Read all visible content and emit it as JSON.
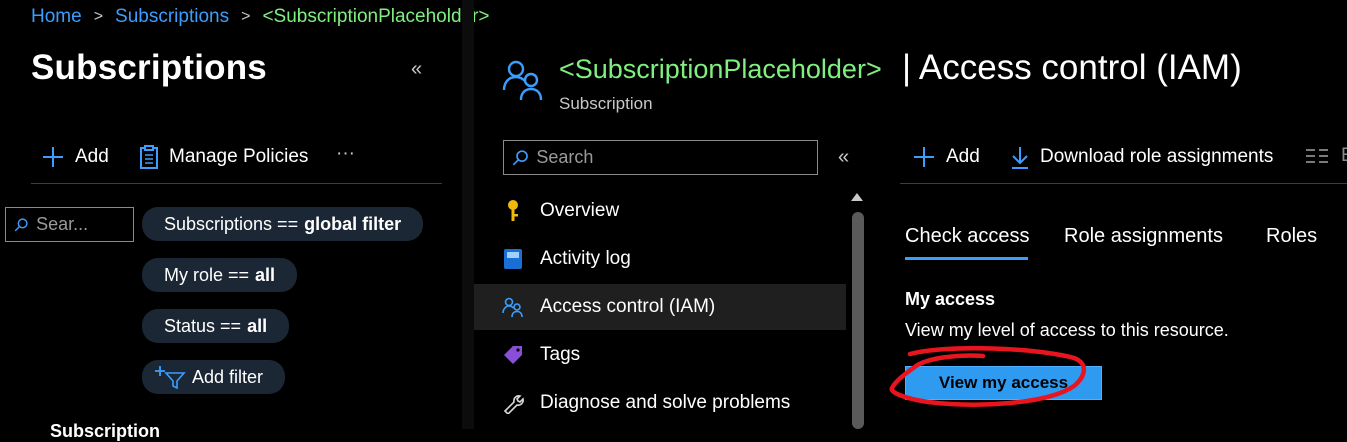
{
  "breadcrumb": {
    "home": "Home",
    "subscriptions": "Subscriptions",
    "current": "<SubscriptionPlaceholder>",
    "separator": ">"
  },
  "left_panel": {
    "title": "Subscriptions",
    "collapse_glyph": "«",
    "toolbar": {
      "add_label": "Add",
      "manage_policies_label": "Manage Policies",
      "more_glyph": "···"
    },
    "search_placeholder": "Sear...",
    "filters": [
      {
        "prefix": "Subscriptions ==",
        "value": "global filter"
      },
      {
        "prefix": "My role ==",
        "value": "all"
      },
      {
        "prefix": "Status ==",
        "value": "all"
      }
    ],
    "add_filter_label": "Add filter",
    "cut_label": "Subscription"
  },
  "resource": {
    "name": "<SubscriptionPlaceholder>",
    "type": "Subscription",
    "page_title": "| Access control (IAM)"
  },
  "nav": {
    "search_placeholder": "Search",
    "collapse_glyph": "«",
    "items": [
      {
        "label": "Overview",
        "icon": "key-icon"
      },
      {
        "label": "Activity log",
        "icon": "activity-log-icon"
      },
      {
        "label": "Access control (IAM)",
        "icon": "people-icon",
        "selected": true
      },
      {
        "label": "Tags",
        "icon": "tag-icon"
      },
      {
        "label": "Diagnose and solve problems",
        "icon": "wrench-icon"
      }
    ]
  },
  "iam": {
    "toolbar": {
      "add_label": "Add",
      "download_label": "Download role assignments",
      "edit_cols_glyph": "E"
    },
    "tabs": [
      "Check access",
      "Role assignments",
      "Roles"
    ],
    "active_tab": 0,
    "my_access": {
      "heading": "My access",
      "description": "View my level of access to this resource.",
      "button_label": "View my access"
    }
  },
  "colors": {
    "link": "#3b9eff",
    "placeholder_green": "#7ff07f",
    "primary_button": "#2e9bf0",
    "annotation_red": "#e8141e",
    "pill_bg": "#1b2734"
  }
}
